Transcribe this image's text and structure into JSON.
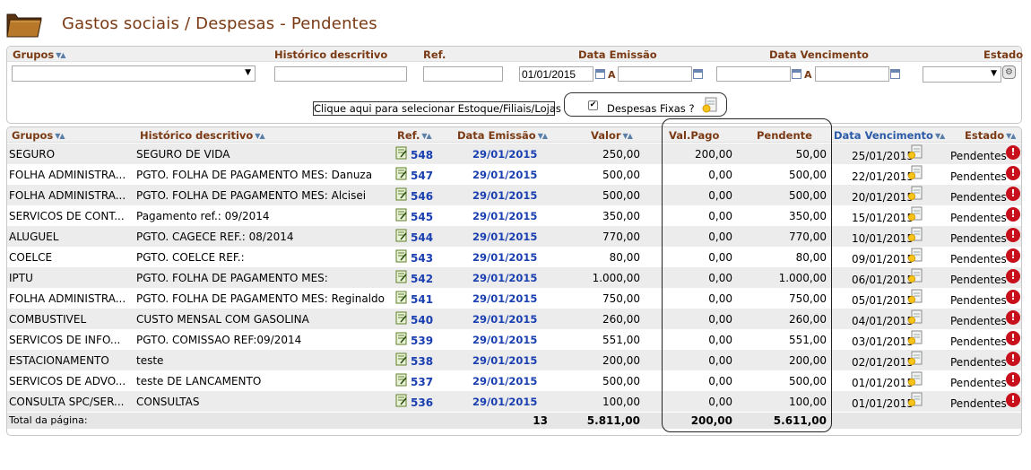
{
  "page": {
    "title": "Gastos sociais / Despesas - Pendentes"
  },
  "filters": {
    "headers": {
      "grupos": "Grupos",
      "historico": "Histórico descritivo",
      "ref": "Ref.",
      "data_emissao": "Data Emissão",
      "data_vencimento": "Data Vencimento",
      "estado": "Estado"
    },
    "grupos_value": "",
    "historico_value": "",
    "ref_value": "",
    "emissao_from": "01/01/2015",
    "emissao_to": "",
    "vencimento_from": "",
    "vencimento_to": "",
    "estado_value": "",
    "a_label": "A",
    "stock_button": "Clique aqui para selecionar Estoque/Filiais/Lojas",
    "fixas_label": "Despesas Fixas ?",
    "fixas_checked": true
  },
  "table": {
    "columns": {
      "grupos": "Grupos",
      "historico": "Histórico descritivo",
      "ref": "Ref.",
      "data_emissao": "Data Emissão",
      "valor": "Valor",
      "val_pago": "Val.Pago",
      "pendente": "Pendente",
      "data_vencimento": "Data Vencimento",
      "estado": "Estado"
    },
    "rows": [
      {
        "grupo": "SEGURO",
        "historico": "SEGURO DE VIDA",
        "ref": "548",
        "emissao": "29/01/2015",
        "valor": "250,00",
        "pago": "200,00",
        "pendente": "50,00",
        "vencimento": "25/01/2015",
        "estado": "Pendentes"
      },
      {
        "grupo": "FOLHA ADMINISTRA...",
        "historico": "PGTO. FOLHA DE PAGAMENTO MES: Danuza",
        "ref": "547",
        "emissao": "29/01/2015",
        "valor": "500,00",
        "pago": "0,00",
        "pendente": "500,00",
        "vencimento": "22/01/2015",
        "estado": "Pendentes"
      },
      {
        "grupo": "FOLHA ADMINISTRA...",
        "historico": "PGTO. FOLHA DE PAGAMENTO MES: Alcisei",
        "ref": "546",
        "emissao": "29/01/2015",
        "valor": "500,00",
        "pago": "0,00",
        "pendente": "500,00",
        "vencimento": "20/01/2015",
        "estado": "Pendentes"
      },
      {
        "grupo": "SERVICOS DE CONT...",
        "historico": "Pagamento ref.: 09/2014",
        "ref": "545",
        "emissao": "29/01/2015",
        "valor": "350,00",
        "pago": "0,00",
        "pendente": "350,00",
        "vencimento": "15/01/2015",
        "estado": "Pendentes"
      },
      {
        "grupo": "ALUGUEL",
        "historico": "PGTO. CAGECE REF.: 08/2014",
        "ref": "544",
        "emissao": "29/01/2015",
        "valor": "770,00",
        "pago": "0,00",
        "pendente": "770,00",
        "vencimento": "10/01/2015",
        "estado": "Pendentes"
      },
      {
        "grupo": "COELCE",
        "historico": "PGTO. COELCE REF.:",
        "ref": "543",
        "emissao": "29/01/2015",
        "valor": "80,00",
        "pago": "0,00",
        "pendente": "80,00",
        "vencimento": "09/01/2015",
        "estado": "Pendentes"
      },
      {
        "grupo": "IPTU",
        "historico": "PGTO. FOLHA DE PAGAMENTO MES:",
        "ref": "542",
        "emissao": "29/01/2015",
        "valor": "1.000,00",
        "pago": "0,00",
        "pendente": "1.000,00",
        "vencimento": "06/01/2015",
        "estado": "Pendentes"
      },
      {
        "grupo": "FOLHA ADMINISTRA...",
        "historico": "PGTO. FOLHA DE PAGAMENTO MES: Reginaldo",
        "ref": "541",
        "emissao": "29/01/2015",
        "valor": "750,00",
        "pago": "0,00",
        "pendente": "750,00",
        "vencimento": "05/01/2015",
        "estado": "Pendentes"
      },
      {
        "grupo": "COMBUSTIVEL",
        "historico": "CUSTO MENSAL COM GASOLINA",
        "ref": "540",
        "emissao": "29/01/2015",
        "valor": "260,00",
        "pago": "0,00",
        "pendente": "260,00",
        "vencimento": "04/01/2015",
        "estado": "Pendentes"
      },
      {
        "grupo": "SERVICOS DE INFO...",
        "historico": "PGTO. COMISSAO REF:09/2014",
        "ref": "539",
        "emissao": "29/01/2015",
        "valor": "551,00",
        "pago": "0,00",
        "pendente": "551,00",
        "vencimento": "03/01/2015",
        "estado": "Pendentes"
      },
      {
        "grupo": "ESTACIONAMENTO",
        "historico": "teste",
        "ref": "538",
        "emissao": "29/01/2015",
        "valor": "200,00",
        "pago": "0,00",
        "pendente": "200,00",
        "vencimento": "02/01/2015",
        "estado": "Pendentes"
      },
      {
        "grupo": "SERVICOS DE ADVO...",
        "historico": "teste DE LANCAMENTO",
        "ref": "537",
        "emissao": "29/01/2015",
        "valor": "500,00",
        "pago": "0,00",
        "pendente": "500,00",
        "vencimento": "01/01/2015",
        "estado": "Pendentes"
      },
      {
        "grupo": "CONSULTA SPC/SER...",
        "historico": "CONSULTAS",
        "ref": "536",
        "emissao": "29/01/2015",
        "valor": "100,00",
        "pago": "0,00",
        "pendente": "100,00",
        "vencimento": "01/01/2015",
        "estado": "Pendentes"
      }
    ],
    "totals": {
      "label": "Total da página:",
      "count": "13",
      "valor": "5.811,00",
      "pago": "200,00",
      "pendente": "5.611,00"
    }
  },
  "colors": {
    "header_brown": "#7a3a14",
    "link_blue": "#1a3fb0",
    "alert_red": "#c8101c"
  },
  "icons": {
    "folder": "folder-icon",
    "note": "note-edit-icon",
    "venc": "sun-document-icon",
    "alert": "alert-icon",
    "calendar": "calendar-icon",
    "gear": "gear-icon"
  }
}
